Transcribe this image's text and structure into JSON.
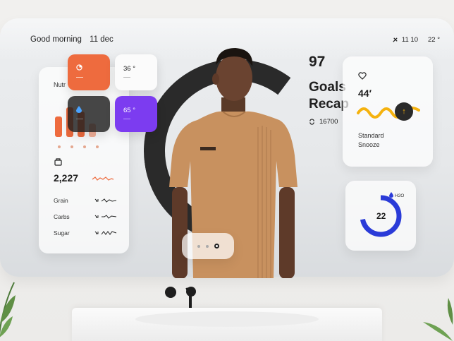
{
  "header": {
    "greeting": "Good morning",
    "date": "11 dec",
    "time": "11 10",
    "temperature": "22 °"
  },
  "nutrition": {
    "title": "Nutr",
    "kcal": "2,227",
    "rows": [
      {
        "label": "Grain"
      },
      {
        "label": "Carbs"
      },
      {
        "label": "Sugar"
      }
    ],
    "bar_levels": [
      0.7,
      1.0,
      0.85,
      0.45
    ],
    "colors": {
      "bar": "#ee6b3e",
      "accent": "#e4a78f"
    }
  },
  "tiles": {
    "white_value": "36 °",
    "purple_value": "65 °"
  },
  "goals": {
    "number": "97",
    "title_line1": "Goals",
    "title_line2": "Recap",
    "steps": "16700"
  },
  "snooze": {
    "value": "44′",
    "label_line1": "Standard",
    "label_line2": "Snooze"
  },
  "water": {
    "value": "22",
    "unit": "H2O",
    "level": 0.72,
    "color": "#2a3bd8"
  },
  "pager": {
    "count": 3,
    "active": 2
  },
  "icons": [
    "pie-icon",
    "drop-icon",
    "heart-icon",
    "bag-icon",
    "steps-icon",
    "arrow-up-icon",
    "water-drop-icon",
    "sun-icon"
  ]
}
